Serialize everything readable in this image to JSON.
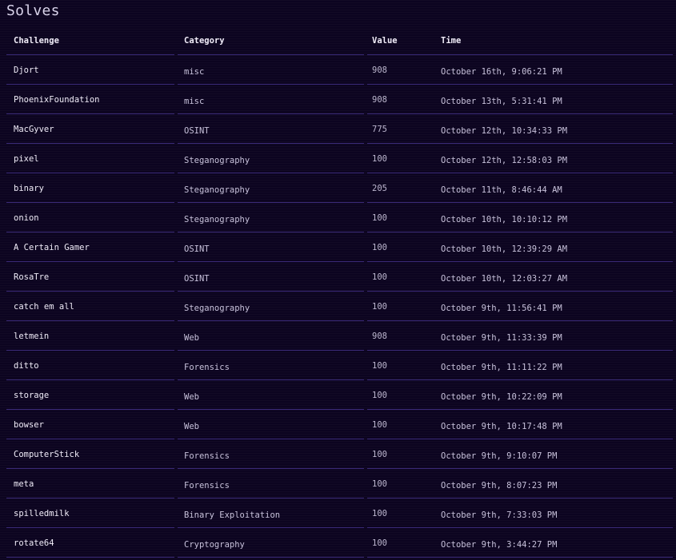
{
  "page": {
    "title": "Solves"
  },
  "table": {
    "headers": {
      "challenge": "Challenge",
      "category": "Category",
      "value": "Value",
      "time": "Time"
    },
    "rows": [
      {
        "challenge": "Djort",
        "category": "misc",
        "value": "908",
        "time": "October 16th, 9:06:21 PM"
      },
      {
        "challenge": "PhoenixFoundation",
        "category": "misc",
        "value": "908",
        "time": "October 13th, 5:31:41 PM"
      },
      {
        "challenge": "MacGyver",
        "category": "OSINT",
        "value": "775",
        "time": "October 12th, 10:34:33 PM"
      },
      {
        "challenge": "pixel",
        "category": "Steganography",
        "value": "100",
        "time": "October 12th, 12:58:03 PM"
      },
      {
        "challenge": "binary",
        "category": "Steganography",
        "value": "205",
        "time": "October 11th, 8:46:44 AM"
      },
      {
        "challenge": "onion",
        "category": "Steganography",
        "value": "100",
        "time": "October 10th, 10:10:12 PM"
      },
      {
        "challenge": "A Certain Gamer",
        "category": "OSINT",
        "value": "100",
        "time": "October 10th, 12:39:29 AM"
      },
      {
        "challenge": "RosaTre",
        "category": "OSINT",
        "value": "100",
        "time": "October 10th, 12:03:27 AM"
      },
      {
        "challenge": "catch em all",
        "category": "Steganography",
        "value": "100",
        "time": "October 9th, 11:56:41 PM"
      },
      {
        "challenge": "letmein",
        "category": "Web",
        "value": "908",
        "time": "October 9th, 11:33:39 PM"
      },
      {
        "challenge": "ditto",
        "category": "Forensics",
        "value": "100",
        "time": "October 9th, 11:11:22 PM"
      },
      {
        "challenge": "storage",
        "category": "Web",
        "value": "100",
        "time": "October 9th, 10:22:09 PM"
      },
      {
        "challenge": "bowser",
        "category": "Web",
        "value": "100",
        "time": "October 9th, 10:17:48 PM"
      },
      {
        "challenge": "ComputerStick",
        "category": "Forensics",
        "value": "100",
        "time": "October 9th, 9:10:07 PM"
      },
      {
        "challenge": "meta",
        "category": "Forensics",
        "value": "100",
        "time": "October 9th, 8:07:23 PM"
      },
      {
        "challenge": "spilledmilk",
        "category": "Binary Exploitation",
        "value": "100",
        "time": "October 9th, 7:33:03 PM"
      },
      {
        "challenge": "rotate64",
        "category": "Cryptography",
        "value": "100",
        "time": "October 9th, 3:44:27 PM"
      }
    ]
  },
  "colors": {
    "background": "#0c0420",
    "separator": "#3a2a78",
    "text": "#e6e1f2"
  }
}
